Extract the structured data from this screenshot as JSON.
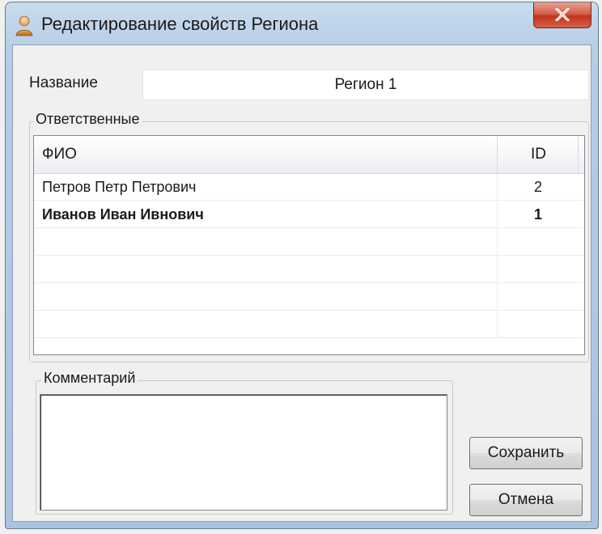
{
  "window": {
    "title": "Редактирование свойств Региона",
    "close_symbol": "X"
  },
  "name_field": {
    "label": "Название",
    "value": "Регион 1"
  },
  "responsibles": {
    "group_label": "Ответственные",
    "columns": [
      "ФИО",
      "ID"
    ],
    "rows": [
      {
        "fio": "Петров Петр Петрович",
        "id": "2",
        "bold": false
      },
      {
        "fio": "Иванов Иван Ивнович",
        "id": "1",
        "bold": true
      }
    ]
  },
  "comment": {
    "group_label": "Комментарий",
    "value": ""
  },
  "buttons": {
    "save": "Сохранить",
    "cancel": "Отмена"
  },
  "icons": {
    "title": "user-icon",
    "close": "close-icon"
  }
}
